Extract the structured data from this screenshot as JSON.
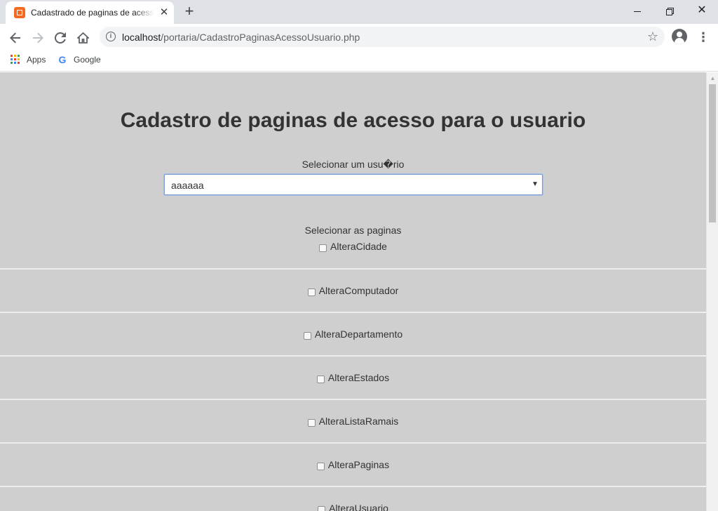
{
  "browser": {
    "tab_title": "Cadastrado de paginas de acesso para o usuario",
    "tab_close": "✕",
    "new_tab": "+",
    "window_close": "✕",
    "url_host": "localhost",
    "url_path": "/portaria/CadastroPaginasAcessoUsuario.php",
    "bookmarks": [
      {
        "label": "Apps",
        "icon": "apps-grid-icon"
      },
      {
        "label": "Google",
        "icon": "google-icon"
      }
    ],
    "accent_colors": {
      "favicon": "#f26b21",
      "tabstrip": "#dee1e6"
    }
  },
  "page": {
    "title": "Cadastro de paginas de acesso para o usuario",
    "user_label": "Selecionar um usu�rio",
    "user_select_value": "aaaaaa",
    "pages_label": "Selecionar as paginas",
    "pages": [
      {
        "label": "AlteraCidade",
        "checked": false
      },
      {
        "label": "AlteraComputador",
        "checked": false
      },
      {
        "label": "AlteraDepartamento",
        "checked": false
      },
      {
        "label": "AlteraEstados",
        "checked": false
      },
      {
        "label": "AlteraListaRamais",
        "checked": false
      },
      {
        "label": "AlteraPaginas",
        "checked": false
      },
      {
        "label": "AlteraUsuario",
        "checked": false
      }
    ],
    "background_color": "#cfcfcf"
  }
}
